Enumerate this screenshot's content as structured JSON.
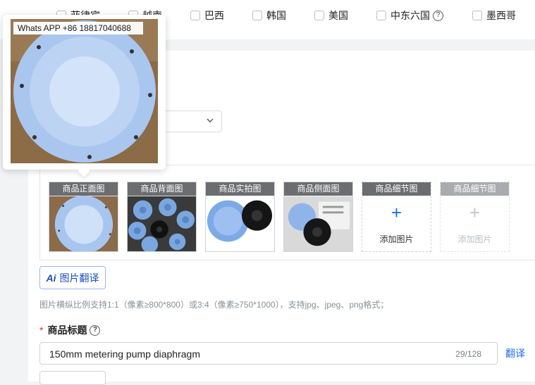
{
  "countries": [
    {
      "label": "菲律宾"
    },
    {
      "label": "越南"
    },
    {
      "label": "巴西"
    },
    {
      "label": "韩国"
    },
    {
      "label": "美国"
    },
    {
      "label": "中东六国",
      "help_icon": "question-circle-icon"
    },
    {
      "label": "墨西哥"
    }
  ],
  "image_slots": [
    {
      "label": "商品正面图",
      "filled": true
    },
    {
      "label": "商品背面图",
      "filled": true
    },
    {
      "label": "商品实拍图",
      "filled": true
    },
    {
      "label": "商品侧面图",
      "filled": true
    },
    {
      "label": "商品细节图",
      "filled": false,
      "add_label": "添加图片"
    },
    {
      "label": "商品细节图",
      "filled": false,
      "add_label": "添加图片",
      "disabled": true
    }
  ],
  "ai_translate": {
    "icon": "Ai",
    "label": "图片翻译"
  },
  "image_hint": "图片横纵比例支持1:1（像素≥800*800）或3:4（像素≥750*1000），支持jpg、jpeg、png格式；",
  "product_title": {
    "label": "商品标题",
    "required_mark": "*",
    "value": "150mm metering pump diaphragm",
    "count": "29/128",
    "translate_label": "翻译"
  },
  "preview": {
    "caption": "Whats APP +86 18817040688"
  },
  "add_symbol": "+",
  "colors": {
    "accent": "#1f6feb",
    "required": "#e0301e",
    "slot_label_bg": "#6b6d71"
  }
}
